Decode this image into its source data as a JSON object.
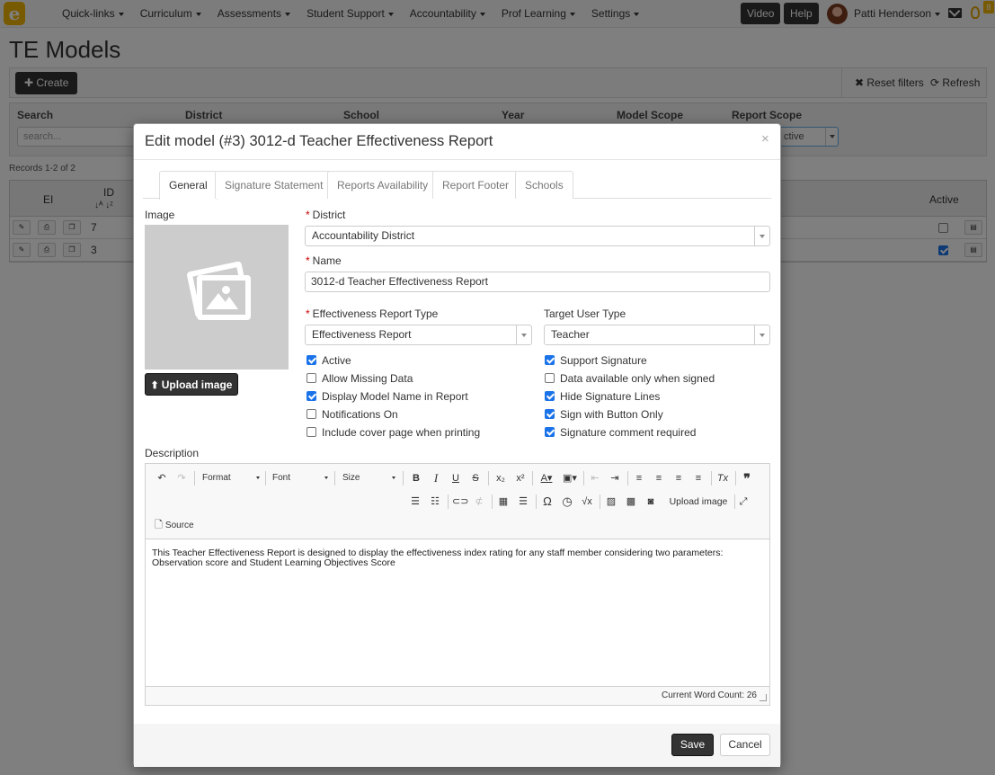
{
  "nav": {
    "logo": "e",
    "links": [
      "Quick-links",
      "Curriculum",
      "Assessments",
      "Student Support",
      "Accountability",
      "Prof Learning",
      "Settings"
    ],
    "video": "Video",
    "help": "Help",
    "user": "Patti Henderson",
    "badge": "8"
  },
  "page": {
    "title": "TE Models",
    "create": "Create",
    "reset_filters": "Reset filters",
    "refresh": "Refresh",
    "filters": {
      "search_label": "Search",
      "search_placeholder": "search...",
      "district": "District",
      "school": "School",
      "year": "Year",
      "model_scope": "Model Scope",
      "report_scope": "Report Scope",
      "report_scope_value": "ctive"
    },
    "records": "Records 1-2 of 2",
    "grid": {
      "col_ei": "EI",
      "col_id": "ID",
      "col_active": "Active",
      "rows": [
        {
          "id": "7",
          "active": false
        },
        {
          "id": "3",
          "active": true
        }
      ]
    }
  },
  "modal": {
    "title": "Edit model (#3) 3012-d Teacher Effectiveness Report",
    "close": "×",
    "tabs": [
      "General",
      "Signature Statement",
      "Reports Availability",
      "Report Footer",
      "Schools"
    ],
    "image_label": "Image",
    "upload_label": "Upload image",
    "district_label": "District",
    "district_value": "Accountability District",
    "name_label": "Name",
    "name_value": "3012-d Teacher Effectiveness Report",
    "ert_label": "Effectiveness Report Type",
    "ert_value": "Effectiveness Report",
    "tut_label": "Target User Type",
    "tut_value": "Teacher",
    "checks_left": [
      {
        "label": "Active",
        "checked": true
      },
      {
        "label": "Allow Missing Data",
        "checked": false
      },
      {
        "label": "Display Model Name in Report",
        "checked": true
      },
      {
        "label": "Notifications On",
        "checked": false
      },
      {
        "label": "Include cover page when printing",
        "checked": false
      }
    ],
    "checks_right": [
      {
        "label": "Support Signature",
        "checked": true
      },
      {
        "label": "Data available only when signed",
        "checked": false
      },
      {
        "label": "Hide Signature Lines",
        "checked": true
      },
      {
        "label": "Sign with Button Only",
        "checked": true
      },
      {
        "label": "Signature comment required",
        "checked": true
      }
    ],
    "description_label": "Description",
    "editor": {
      "format": "Format",
      "font": "Font",
      "size": "Size",
      "upload_image": "Upload image",
      "source": "Source",
      "content": "This Teacher Effectiveness Report is designed to display the effectiveness index rating for any staff member considering two parameters: Observation score and Student Learning Objectives Score",
      "word_count": "Current Word Count: 26"
    },
    "save": "Save",
    "cancel": "Cancel"
  }
}
